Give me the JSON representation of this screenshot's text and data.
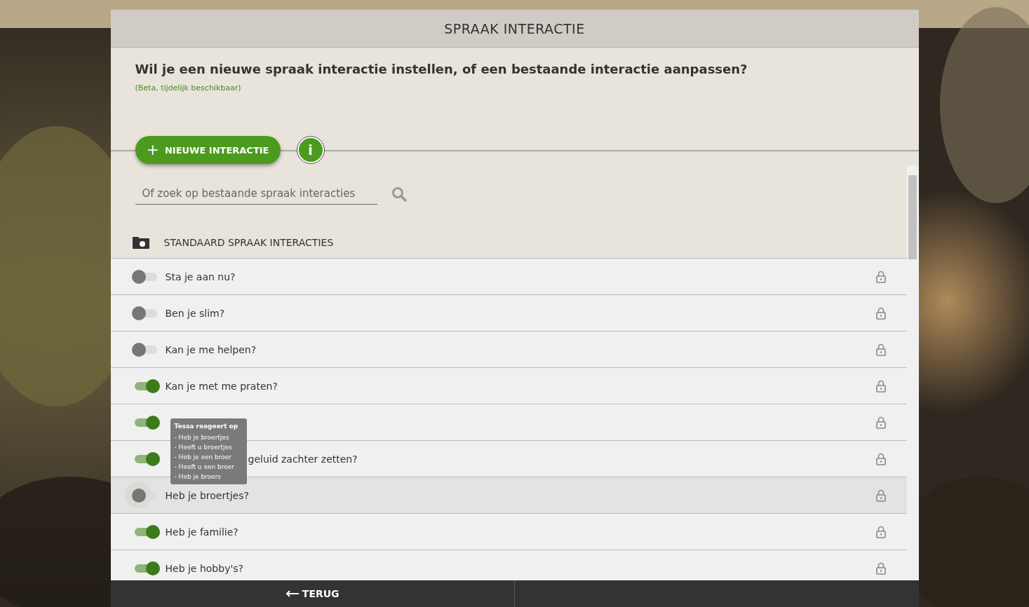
{
  "window": {
    "title": "SPRAAK INTERACTIE"
  },
  "question": "Wil je een nieuwe spraak interactie instellen, of een bestaande interactie aanpassen?",
  "note": "(Beta, tijdelijk beschikbaar)",
  "new_button": {
    "icon": "+",
    "label": "NIEUWE INTERACTIE"
  },
  "info_button": {
    "label": "i"
  },
  "search": {
    "placeholder": "Of zoek op bestaande spraak interacties"
  },
  "section": {
    "title": "STANDAARD SPRAAK INTERACTIES"
  },
  "rows": [
    {
      "label": "Sta je aan nu?",
      "on": false,
      "hovered": false,
      "under_tooltip": false
    },
    {
      "label": "Ben je slim?",
      "on": false,
      "hovered": false,
      "under_tooltip": false
    },
    {
      "label": "Kan je me helpen?",
      "on": false,
      "hovered": false,
      "under_tooltip": false
    },
    {
      "label": "Kan je met me praten?",
      "on": true,
      "hovered": false,
      "under_tooltip": false
    },
    {
      "on": true,
      "hovered": false
    },
    {
      "label": "geluid zachter zetten?",
      "on": true,
      "hovered": false,
      "under_tooltip": true
    },
    {
      "label": "Heb je broertjes?",
      "on": false,
      "hovered": true,
      "under_tooltip": false
    },
    {
      "label": "Heb je familie?",
      "on": true,
      "hovered": false,
      "under_tooltip": false
    },
    {
      "label": "Heb je hobby's?",
      "on": true,
      "hovered": false,
      "under_tooltip": false
    }
  ],
  "tooltip": {
    "title": "Tessa reageert op",
    "lines": [
      "- Heb je broertjes",
      "- Heeft u broertjes",
      "- Heb je een broer",
      "- Heeft u een broer",
      "- Heb je broers"
    ]
  },
  "footer": {
    "back_label": "TERUG"
  }
}
